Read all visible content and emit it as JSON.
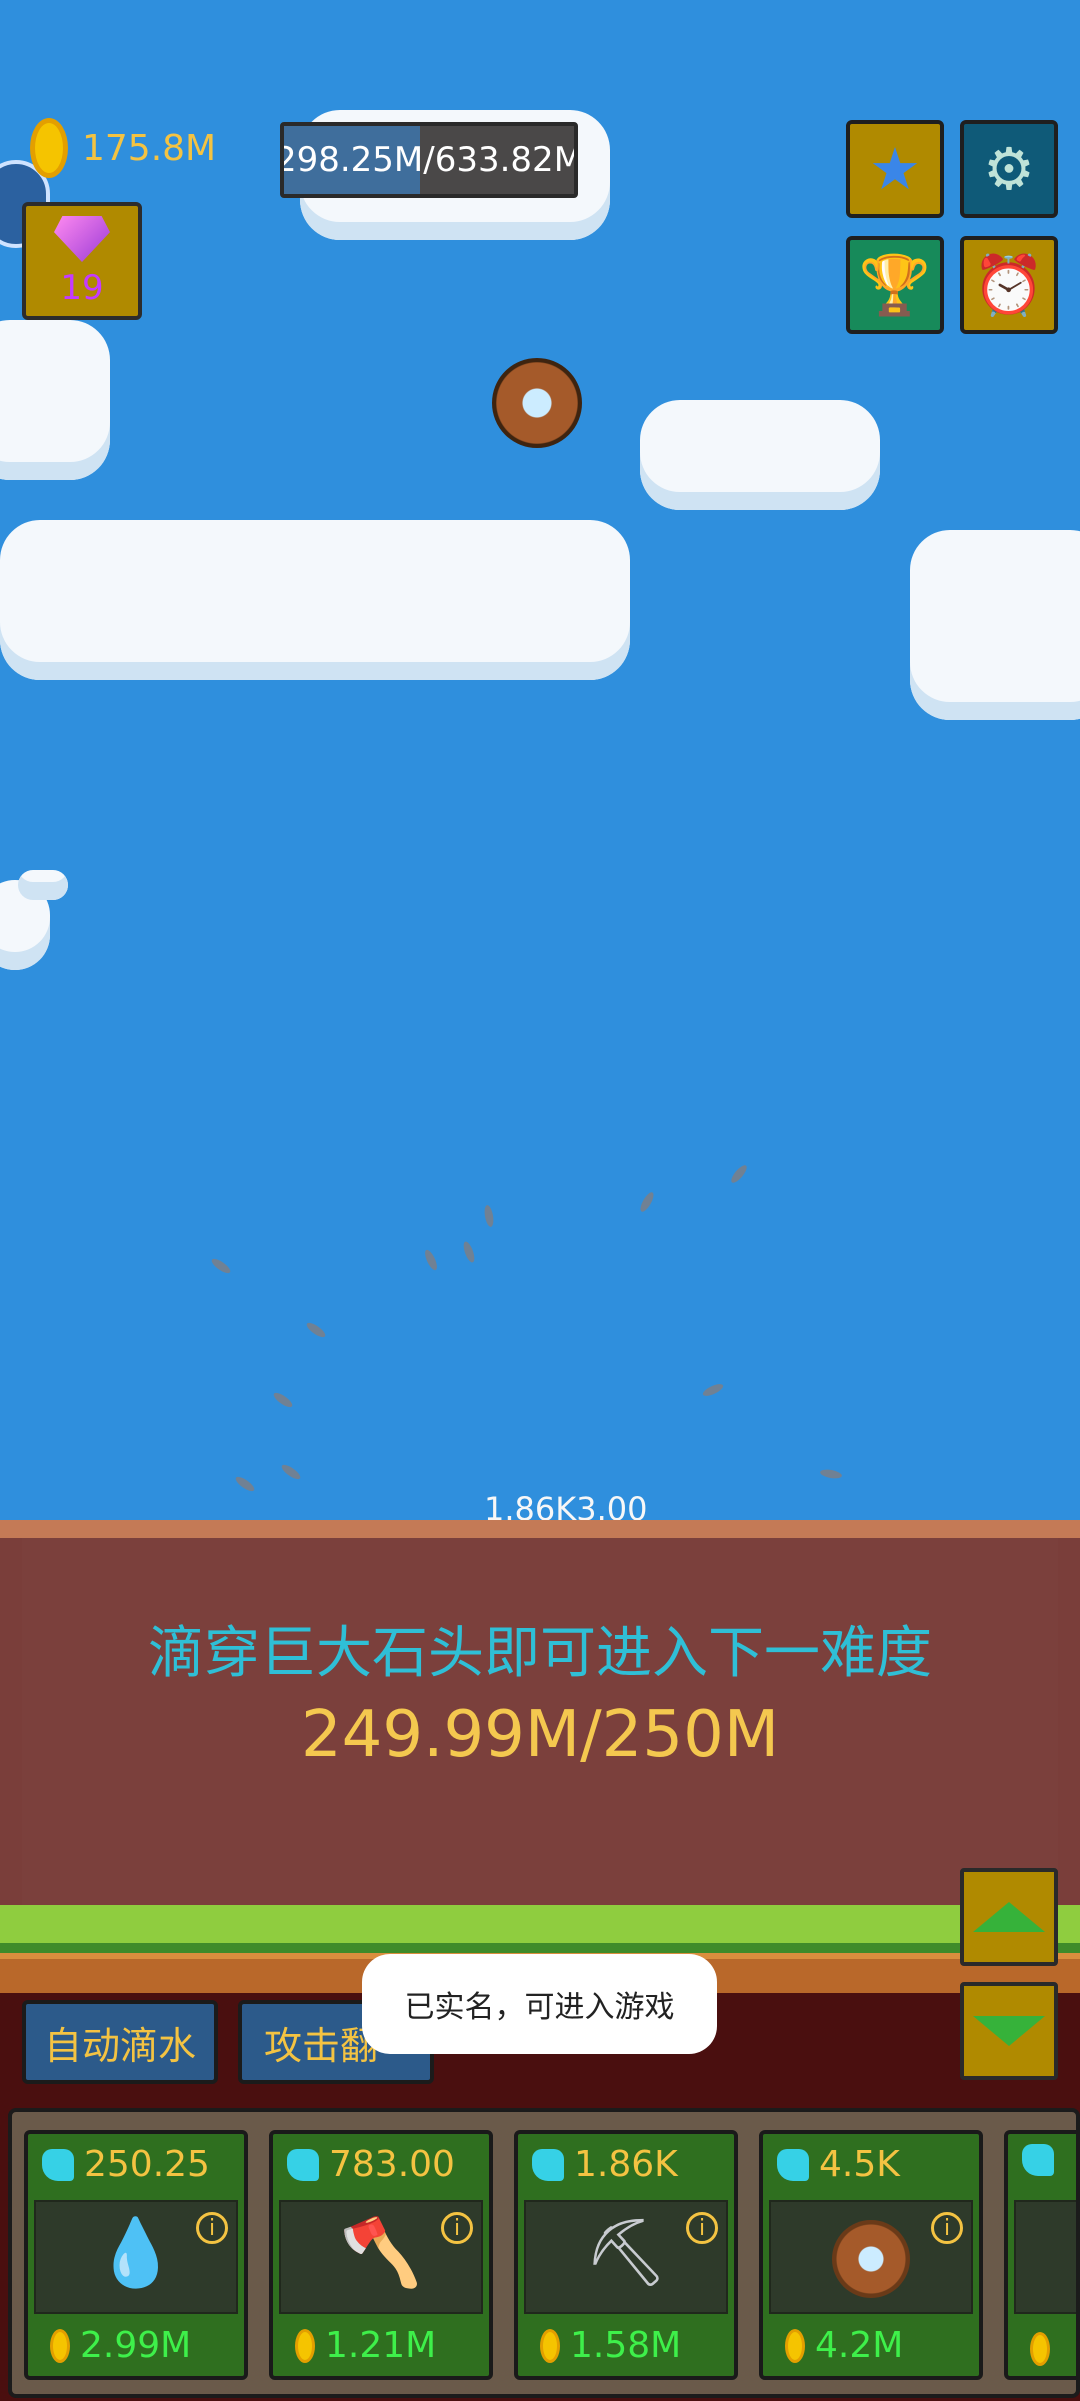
{
  "hud": {
    "coins": "175.8M",
    "gems": "19",
    "hp_text": "298.25M/633.82M",
    "hp_fraction": 0.47
  },
  "floating_text": "1.86K3.00",
  "panel": {
    "title": "滴穿巨大石头即可进入下一难度",
    "progress": "249.99M/250M"
  },
  "tabs": {
    "auto_drip": "自动滴水",
    "attack": "攻击翻"
  },
  "toast": "已实名，可进入游戏",
  "cards": [
    {
      "damage": "250.25",
      "price": "2.99M",
      "item_icon": "water-drop"
    },
    {
      "damage": "783.00",
      "price": "1.21M",
      "item_icon": "axe"
    },
    {
      "damage": "1.86K",
      "price": "1.58M",
      "item_icon": "shovel"
    },
    {
      "damage": "4.5K",
      "price": "4.2M",
      "item_icon": "shield"
    }
  ],
  "colors": {
    "sky": "#2f8fdd",
    "coin_text": "#f4c342",
    "panel_title": "#2fbfd6",
    "price_text": "#3ef04a"
  }
}
